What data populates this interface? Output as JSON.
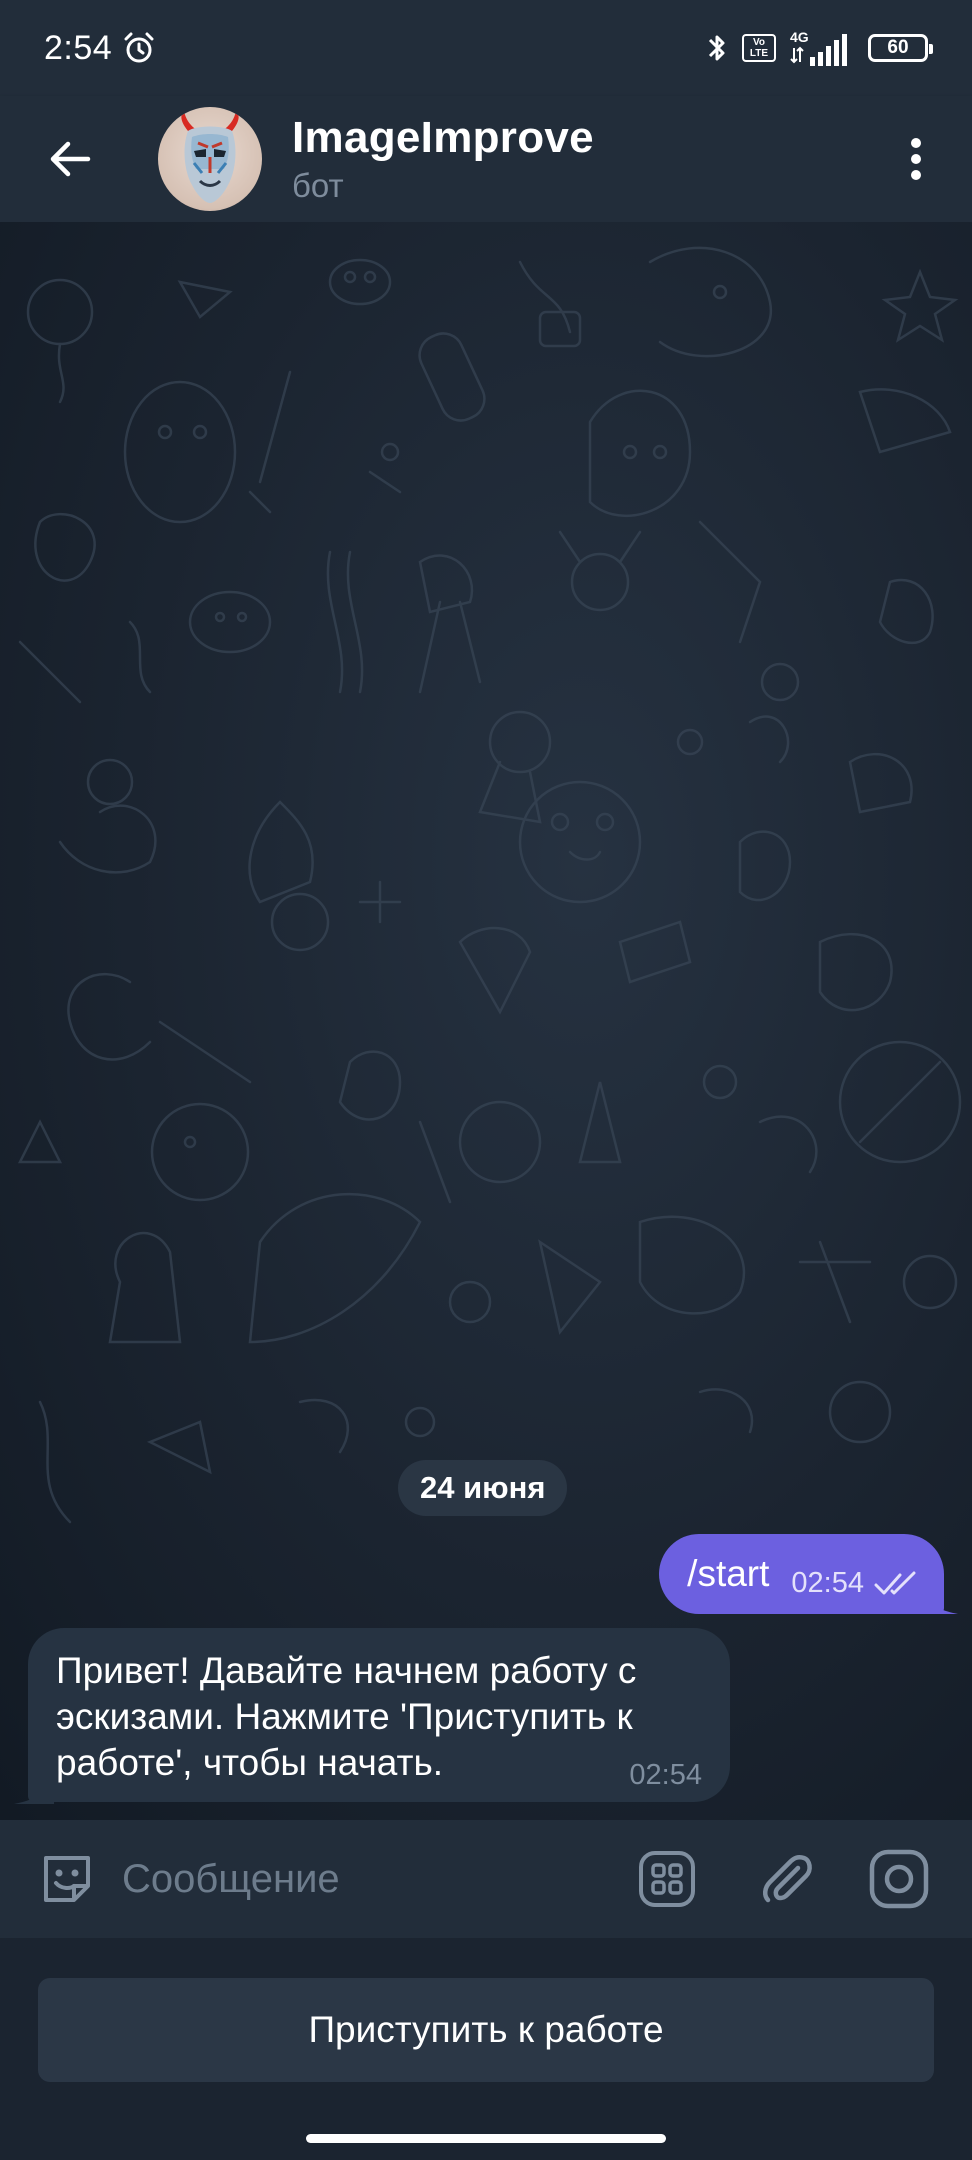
{
  "status_bar": {
    "time": "2:54",
    "battery": "60",
    "network": "4G",
    "volte": "Vo LTE"
  },
  "header": {
    "title": "ImageImprove",
    "subtitle": "бот"
  },
  "chat": {
    "date_label": "24 июня",
    "messages": [
      {
        "direction": "out",
        "text": "/start",
        "time": "02:54",
        "status": "read"
      },
      {
        "direction": "in",
        "text": "Привет! Давайте начнем работу с эскизами. Нажмите 'Приступить к работе', чтобы начать.",
        "time": "02:54"
      }
    ]
  },
  "input": {
    "placeholder": "Сообщение"
  },
  "keyboard": {
    "button_label": "Приступить к работе"
  },
  "colors": {
    "header_bg": "#222d3a",
    "outgoing_bubble": "#6c60e0",
    "incoming_bubble": "#263342",
    "keyboard_button": "#2b3746"
  },
  "icons": [
    "alarm-icon",
    "bluetooth-icon",
    "signal-icon",
    "battery-icon",
    "back-arrow-icon",
    "more-vertical-icon",
    "sticker-icon",
    "bot-menu-icon",
    "paperclip-icon",
    "camera-icon",
    "double-check-icon"
  ]
}
